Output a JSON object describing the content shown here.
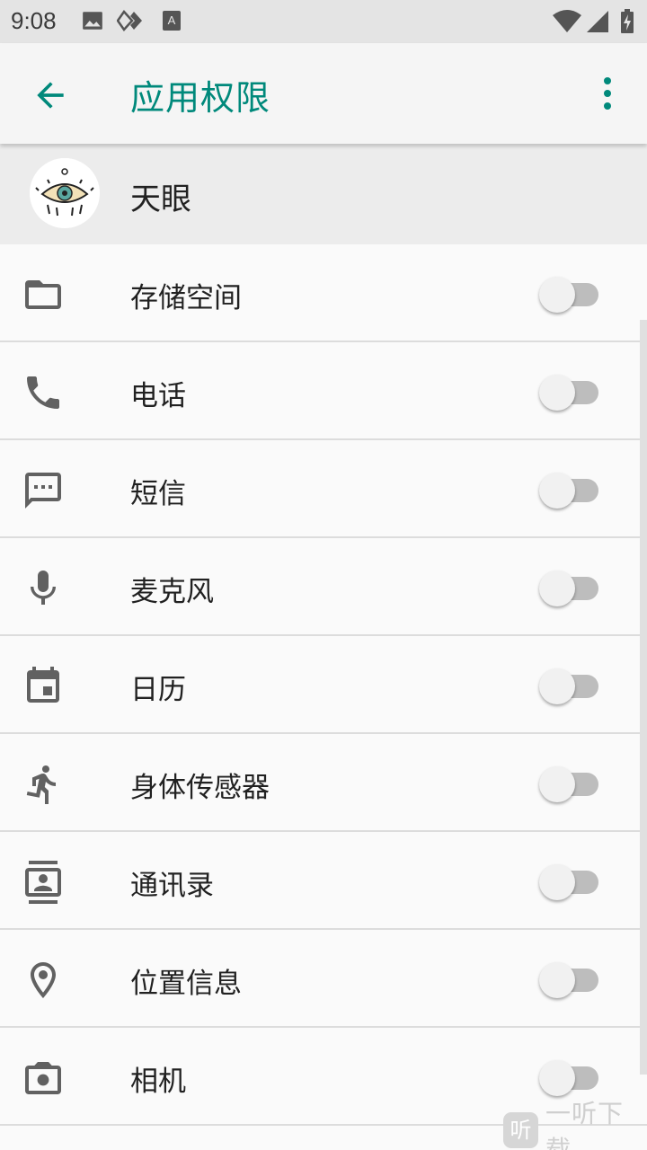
{
  "status_bar": {
    "time": "9:08"
  },
  "app_bar": {
    "title": "应用权限"
  },
  "app": {
    "name": "天眼"
  },
  "permissions": [
    {
      "label": "存储空间",
      "icon": "folder-icon",
      "enabled": false
    },
    {
      "label": "电话",
      "icon": "phone-icon",
      "enabled": false
    },
    {
      "label": "短信",
      "icon": "sms-icon",
      "enabled": false
    },
    {
      "label": "麦克风",
      "icon": "microphone-icon",
      "enabled": false
    },
    {
      "label": "日历",
      "icon": "calendar-icon",
      "enabled": false
    },
    {
      "label": "身体传感器",
      "icon": "body-sensor-icon",
      "enabled": false
    },
    {
      "label": "通讯录",
      "icon": "contacts-icon",
      "enabled": false
    },
    {
      "label": "位置信息",
      "icon": "location-icon",
      "enabled": false
    },
    {
      "label": "相机",
      "icon": "camera-icon",
      "enabled": false
    }
  ],
  "watermark": {
    "icon_text": "听",
    "text": "一听下载"
  },
  "colors": {
    "accent": "#00897b",
    "icon": "#616161",
    "toggle_track": "#bdbdbd"
  }
}
